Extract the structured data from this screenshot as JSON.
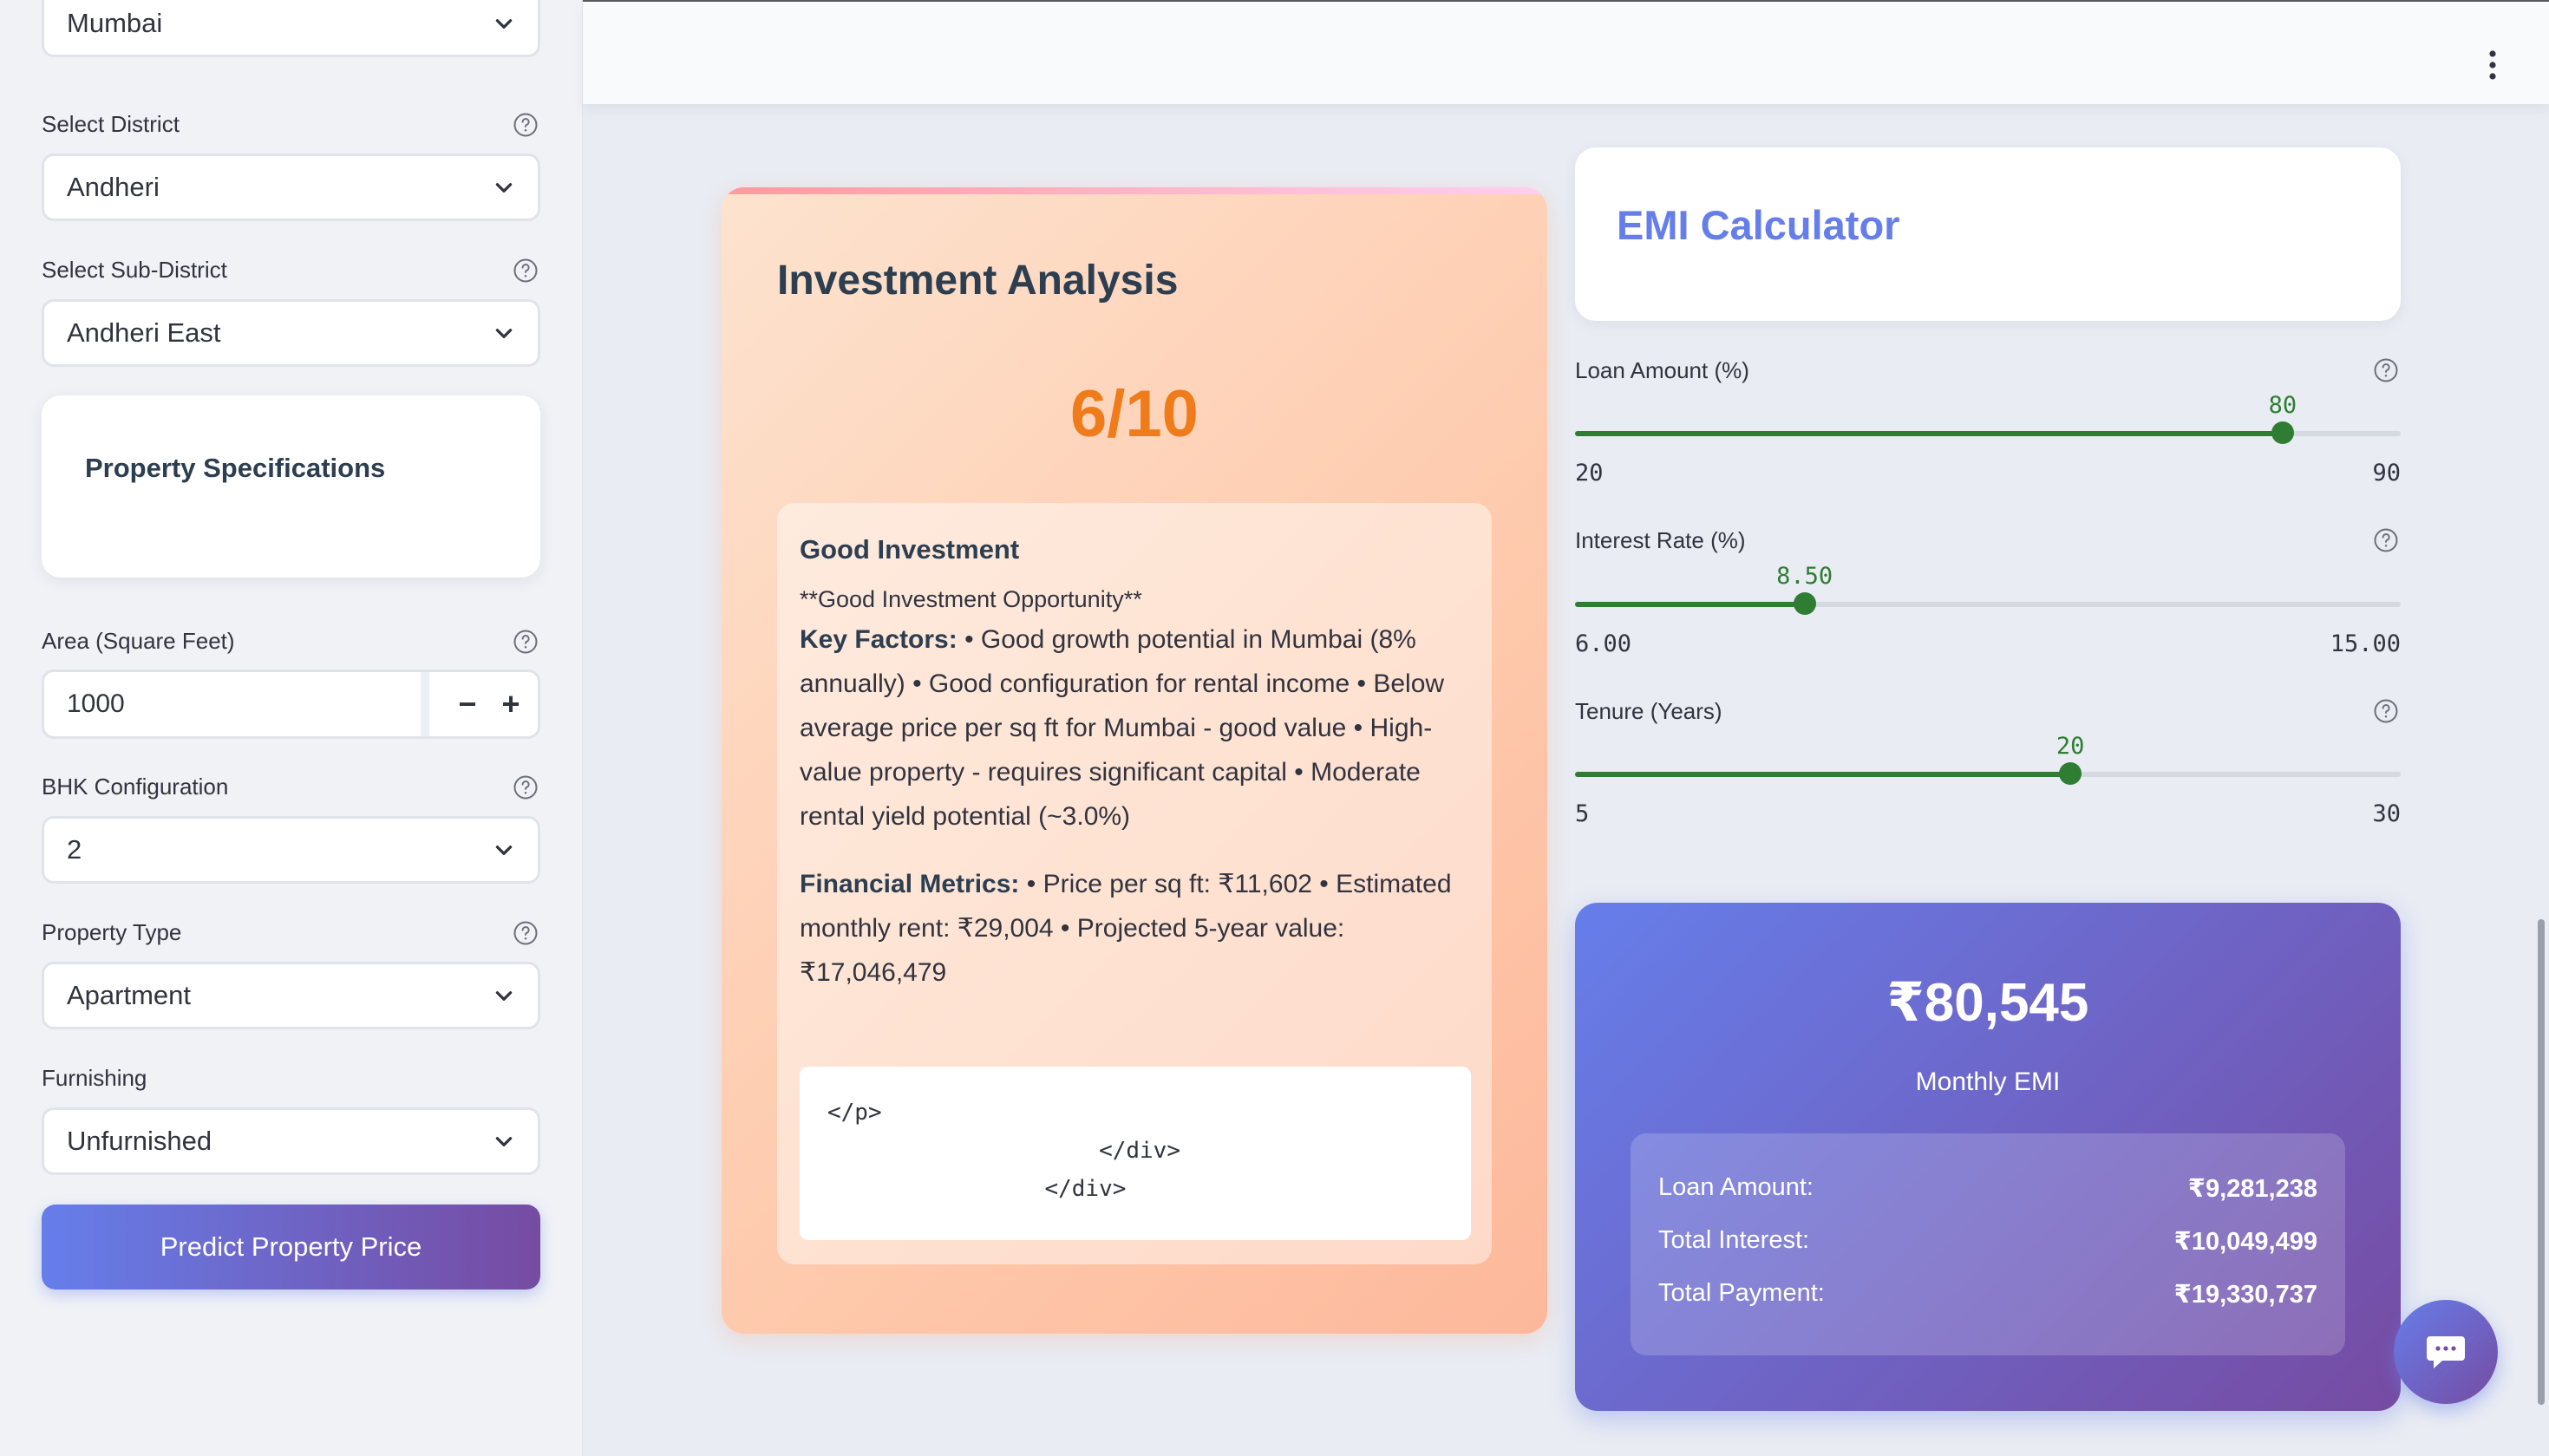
{
  "sidebar": {
    "city_select": {
      "value": "Mumbai"
    },
    "district": {
      "label": "Select District",
      "value": "Andheri"
    },
    "sub_district": {
      "label": "Select Sub-District",
      "value": "Andheri East"
    },
    "spec_card": {
      "title": "Property Specifications"
    },
    "area": {
      "label": "Area (Square Feet)",
      "value": "1000",
      "minus": "−",
      "plus": "+"
    },
    "bhk": {
      "label": "BHK Configuration",
      "value": "2"
    },
    "property_type": {
      "label": "Property Type",
      "value": "Apartment"
    },
    "furnishing": {
      "label": "Furnishing",
      "value": "Unfurnished"
    },
    "predict_button": "Predict Property Price"
  },
  "investment": {
    "title": "Investment Analysis",
    "score": "6/10",
    "verdict": "Good Investment",
    "subtitle": "**Good Investment Opportunity**",
    "key_factors_label": "Key Factors:",
    "key_factors_text": " • Good growth potential in Mumbai (8% annually) • Good configuration for rental income • Below average price per sq ft for Mumbai - good value • High-value property - requires significant capital • Moderate rental yield potential (~3.0%)",
    "financial_metrics_label": "Financial Metrics:",
    "financial_metrics_text": " • Price per sq ft: ₹11,602 • Estimated monthly rent: ₹29,004 • Projected 5-year value: ₹17,046,479",
    "code_lines": [
      "</p>",
      "                    </div>",
      "                </div>"
    ]
  },
  "emi": {
    "title": "EMI Calculator",
    "loan_amount": {
      "label": "Loan Amount (%)",
      "value": "80",
      "min": "20",
      "max": "90",
      "fraction": 0.857
    },
    "interest_rate": {
      "label": "Interest Rate (%)",
      "value": "8.50",
      "min": "6.00",
      "max": "15.00",
      "fraction": 0.278
    },
    "tenure": {
      "label": "Tenure (Years)",
      "value": "20",
      "min": "5",
      "max": "30",
      "fraction": 0.6
    },
    "monthly_emi": "₹80,545",
    "monthly_emi_label": "Monthly EMI",
    "breakdown": [
      {
        "label": "Loan Amount:",
        "value": "₹9,281,238"
      },
      {
        "label": "Total Interest:",
        "value": "₹10,049,499"
      },
      {
        "label": "Total Payment:",
        "value": "₹19,330,737"
      }
    ]
  },
  "colors": {
    "accent": "#667eea",
    "accent_end": "#764ba2",
    "slider": "#2e7d32",
    "score": "#f07b1b"
  },
  "icons": [
    "chevron-down-icon",
    "help-icon",
    "more-vertical-icon",
    "chat-icon"
  ]
}
